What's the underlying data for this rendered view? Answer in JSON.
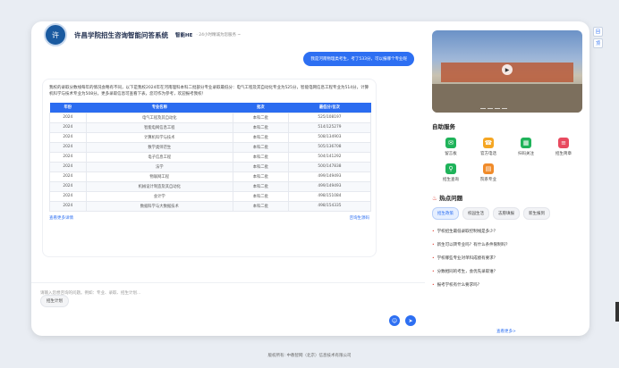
{
  "header": {
    "site_title": "许昌学院招生咨询智能问答系统",
    "brand": "智能HE",
    "tagline": "· 24小时精诚为您服务 ~",
    "logo_text": "许"
  },
  "chat": {
    "user_message": "我是河南物理类考生，考了533分，可以报哪个专业呢",
    "answer_text": "我校的录取分数线每年的情况会略有不同，以下是我校2024年在河南理科本科二批部分专业录取最低分：电气工程及其自动化专业为525分，智能电网信息工程专业为514分，计算机科学与技术专业为508分。更多录取信息可查看下表，您可作为参考，欢迎报考我校！",
    "table": {
      "headers": [
        "年份",
        "专业名称",
        "批次",
        "最低分/位次"
      ],
      "rows": [
        [
          "2024",
          "电气工程及其自动化",
          "本科二批",
          "525/108197"
        ],
        [
          "2024",
          "智能电网信息工程",
          "本科二批",
          "514/125279"
        ],
        [
          "2024",
          "计算机科学与技术",
          "本科二批",
          "508/134903"
        ],
        [
          "2024",
          "数学类师范生",
          "本科二批",
          "505/136708"
        ],
        [
          "2024",
          "电子信息工程",
          "本科二批",
          "504/141292"
        ],
        [
          "2024",
          "法学",
          "本科二批",
          "500/147838"
        ],
        [
          "2024",
          "物联网工程",
          "本科二批",
          "499/149493"
        ],
        [
          "2024",
          "机械设计制造及其自动化",
          "本科二批",
          "499/149493"
        ],
        [
          "2024",
          "会计学",
          "本科二批",
          "498/151084"
        ],
        [
          "2024",
          "数据科学与大数据技术",
          "本科二批",
          "498/154335"
        ]
      ]
    },
    "view_more_link": "查看更多详情",
    "source_link": "咨询生源码",
    "quick_chip": "招生计划",
    "input_placeholder": "请输入您想咨询的问题。例如：专业、录取、招生计划...",
    "icons": {
      "smile": "smile-icon",
      "send": "send-icon"
    }
  },
  "sidebar": {
    "hero_play_icon": "play-icon",
    "services_title": "自助服务",
    "services": [
      {
        "label": "留言板",
        "icon": "chat-bubble-icon",
        "color": "#1fb35a"
      },
      {
        "label": "官方电话",
        "icon": "phone-icon",
        "color": "#f5a623"
      },
      {
        "label": "扫码关注",
        "icon": "qr-code-icon",
        "color": "#1fb35a"
      },
      {
        "label": "招生简章",
        "icon": "document-icon",
        "color": "#e84a5f"
      },
      {
        "label": "招生查询",
        "icon": "search-person-icon",
        "color": "#1fb35a"
      },
      {
        "label": "院系专业",
        "icon": "building-icon",
        "color": "#f08b2a"
      }
    ],
    "hot_title": "热点问题",
    "tabs": [
      "招生政策",
      "校园生活",
      "志愿填报",
      "新生报到"
    ],
    "active_tab": 0,
    "questions": [
      "学校招生最低录取控制线是多少？",
      "新生可以转专业吗？有什么条件限制吗？",
      "学校哪些专业对单科成绩有要求？",
      "分数相同的考生，会优先录取谁？",
      "报考学校有什么要求吗？"
    ],
    "more_link": "查看更多>"
  },
  "side_tools": [
    "回",
    "顶"
  ],
  "footer": "版权所有: 中教智网（北京）信息技术有限公司",
  "colors": {
    "primary": "#2d6ff2",
    "title": "#1f2d4d",
    "hot": "#e0463a"
  }
}
